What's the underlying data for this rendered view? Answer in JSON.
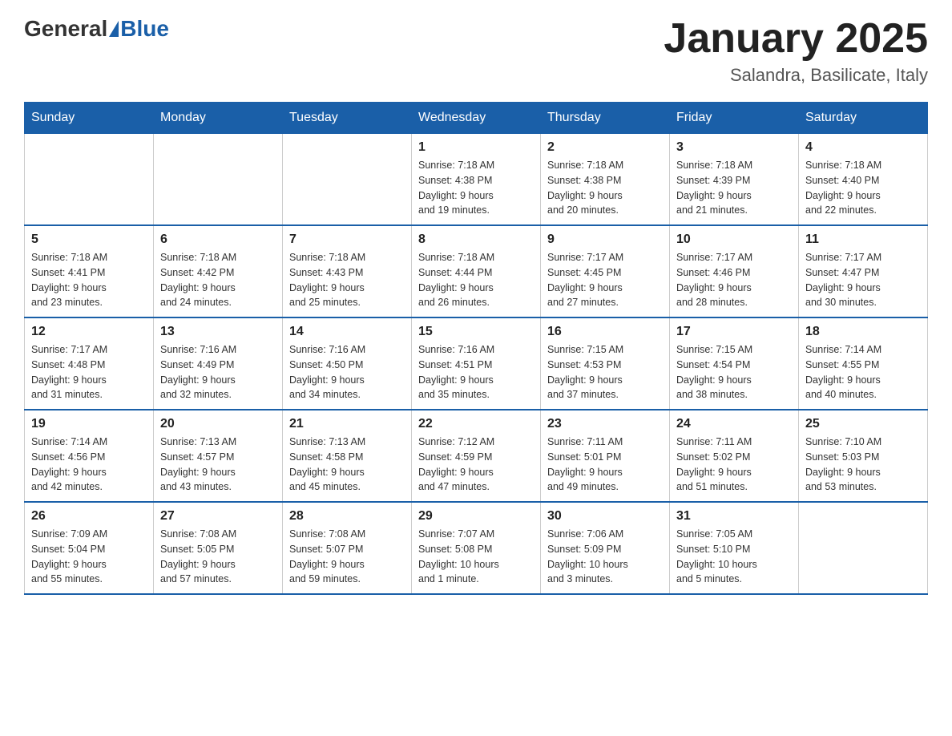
{
  "header": {
    "logo_general": "General",
    "logo_blue": "Blue",
    "month_title": "January 2025",
    "location": "Salandra, Basilicate, Italy"
  },
  "days_of_week": [
    "Sunday",
    "Monday",
    "Tuesday",
    "Wednesday",
    "Thursday",
    "Friday",
    "Saturday"
  ],
  "weeks": [
    [
      {
        "day": "",
        "info": ""
      },
      {
        "day": "",
        "info": ""
      },
      {
        "day": "",
        "info": ""
      },
      {
        "day": "1",
        "info": "Sunrise: 7:18 AM\nSunset: 4:38 PM\nDaylight: 9 hours\nand 19 minutes."
      },
      {
        "day": "2",
        "info": "Sunrise: 7:18 AM\nSunset: 4:38 PM\nDaylight: 9 hours\nand 20 minutes."
      },
      {
        "day": "3",
        "info": "Sunrise: 7:18 AM\nSunset: 4:39 PM\nDaylight: 9 hours\nand 21 minutes."
      },
      {
        "day": "4",
        "info": "Sunrise: 7:18 AM\nSunset: 4:40 PM\nDaylight: 9 hours\nand 22 minutes."
      }
    ],
    [
      {
        "day": "5",
        "info": "Sunrise: 7:18 AM\nSunset: 4:41 PM\nDaylight: 9 hours\nand 23 minutes."
      },
      {
        "day": "6",
        "info": "Sunrise: 7:18 AM\nSunset: 4:42 PM\nDaylight: 9 hours\nand 24 minutes."
      },
      {
        "day": "7",
        "info": "Sunrise: 7:18 AM\nSunset: 4:43 PM\nDaylight: 9 hours\nand 25 minutes."
      },
      {
        "day": "8",
        "info": "Sunrise: 7:18 AM\nSunset: 4:44 PM\nDaylight: 9 hours\nand 26 minutes."
      },
      {
        "day": "9",
        "info": "Sunrise: 7:17 AM\nSunset: 4:45 PM\nDaylight: 9 hours\nand 27 minutes."
      },
      {
        "day": "10",
        "info": "Sunrise: 7:17 AM\nSunset: 4:46 PM\nDaylight: 9 hours\nand 28 minutes."
      },
      {
        "day": "11",
        "info": "Sunrise: 7:17 AM\nSunset: 4:47 PM\nDaylight: 9 hours\nand 30 minutes."
      }
    ],
    [
      {
        "day": "12",
        "info": "Sunrise: 7:17 AM\nSunset: 4:48 PM\nDaylight: 9 hours\nand 31 minutes."
      },
      {
        "day": "13",
        "info": "Sunrise: 7:16 AM\nSunset: 4:49 PM\nDaylight: 9 hours\nand 32 minutes."
      },
      {
        "day": "14",
        "info": "Sunrise: 7:16 AM\nSunset: 4:50 PM\nDaylight: 9 hours\nand 34 minutes."
      },
      {
        "day": "15",
        "info": "Sunrise: 7:16 AM\nSunset: 4:51 PM\nDaylight: 9 hours\nand 35 minutes."
      },
      {
        "day": "16",
        "info": "Sunrise: 7:15 AM\nSunset: 4:53 PM\nDaylight: 9 hours\nand 37 minutes."
      },
      {
        "day": "17",
        "info": "Sunrise: 7:15 AM\nSunset: 4:54 PM\nDaylight: 9 hours\nand 38 minutes."
      },
      {
        "day": "18",
        "info": "Sunrise: 7:14 AM\nSunset: 4:55 PM\nDaylight: 9 hours\nand 40 minutes."
      }
    ],
    [
      {
        "day": "19",
        "info": "Sunrise: 7:14 AM\nSunset: 4:56 PM\nDaylight: 9 hours\nand 42 minutes."
      },
      {
        "day": "20",
        "info": "Sunrise: 7:13 AM\nSunset: 4:57 PM\nDaylight: 9 hours\nand 43 minutes."
      },
      {
        "day": "21",
        "info": "Sunrise: 7:13 AM\nSunset: 4:58 PM\nDaylight: 9 hours\nand 45 minutes."
      },
      {
        "day": "22",
        "info": "Sunrise: 7:12 AM\nSunset: 4:59 PM\nDaylight: 9 hours\nand 47 minutes."
      },
      {
        "day": "23",
        "info": "Sunrise: 7:11 AM\nSunset: 5:01 PM\nDaylight: 9 hours\nand 49 minutes."
      },
      {
        "day": "24",
        "info": "Sunrise: 7:11 AM\nSunset: 5:02 PM\nDaylight: 9 hours\nand 51 minutes."
      },
      {
        "day": "25",
        "info": "Sunrise: 7:10 AM\nSunset: 5:03 PM\nDaylight: 9 hours\nand 53 minutes."
      }
    ],
    [
      {
        "day": "26",
        "info": "Sunrise: 7:09 AM\nSunset: 5:04 PM\nDaylight: 9 hours\nand 55 minutes."
      },
      {
        "day": "27",
        "info": "Sunrise: 7:08 AM\nSunset: 5:05 PM\nDaylight: 9 hours\nand 57 minutes."
      },
      {
        "day": "28",
        "info": "Sunrise: 7:08 AM\nSunset: 5:07 PM\nDaylight: 9 hours\nand 59 minutes."
      },
      {
        "day": "29",
        "info": "Sunrise: 7:07 AM\nSunset: 5:08 PM\nDaylight: 10 hours\nand 1 minute."
      },
      {
        "day": "30",
        "info": "Sunrise: 7:06 AM\nSunset: 5:09 PM\nDaylight: 10 hours\nand 3 minutes."
      },
      {
        "day": "31",
        "info": "Sunrise: 7:05 AM\nSunset: 5:10 PM\nDaylight: 10 hours\nand 5 minutes."
      },
      {
        "day": "",
        "info": ""
      }
    ]
  ]
}
